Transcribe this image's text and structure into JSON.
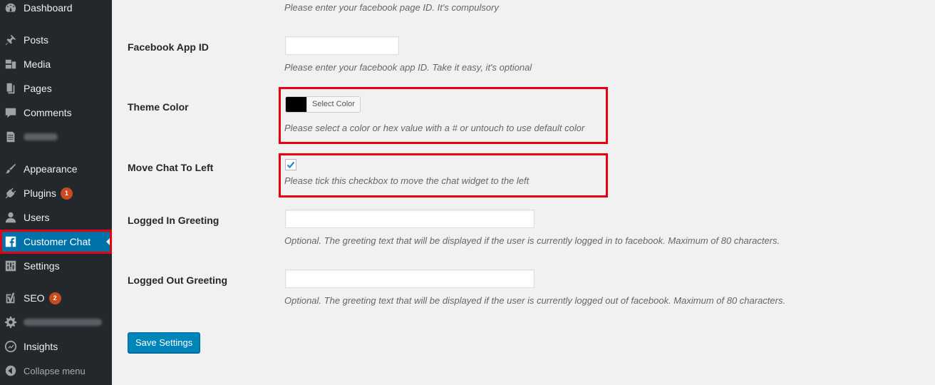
{
  "sidebar": {
    "items": [
      {
        "label": "Dashboard",
        "icon": "dashboard-icon"
      },
      {
        "label": "Posts",
        "icon": "pin-icon"
      },
      {
        "label": "Media",
        "icon": "media-icon"
      },
      {
        "label": "Pages",
        "icon": "pages-icon"
      },
      {
        "label": "Comments",
        "icon": "comment-icon"
      },
      {
        "label": "",
        "icon": "document-icon"
      },
      {
        "label": "Appearance",
        "icon": "paintbrush-icon"
      },
      {
        "label": "Plugins",
        "icon": "plugin-icon",
        "badge": "1"
      },
      {
        "label": "Users",
        "icon": "user-icon"
      },
      {
        "label": "Customer Chat",
        "icon": "facebook-icon"
      },
      {
        "label": "Settings",
        "icon": "settings-icon"
      },
      {
        "label": "SEO",
        "icon": "seo-icon",
        "badge": "2"
      },
      {
        "label": "",
        "icon": "gear-icon"
      },
      {
        "label": "Insights",
        "icon": "insights-icon"
      }
    ],
    "collapse_label": "Collapse menu",
    "active_color": "#0073aa",
    "badge_color": "#ca4a1f"
  },
  "form": {
    "page_id_desc": "Please enter your facebook page ID. It's compulsory",
    "app_id": {
      "label": "Facebook App ID",
      "value": "",
      "desc": "Please enter your facebook app ID. Take it easy, it's optional"
    },
    "theme_color": {
      "label": "Theme Color",
      "value": "#000000",
      "button": "Select Color",
      "desc": "Please select a color or hex value with a # or untouch to use default color"
    },
    "move_left": {
      "label": "Move Chat To Left",
      "checked": true,
      "desc": "Please tick this checkbox to move the chat widget to the left"
    },
    "logged_in": {
      "label": "Logged In Greeting",
      "value": "",
      "desc": "Optional. The greeting text that will be displayed if the user is currently logged in to facebook. Maximum of 80 characters."
    },
    "logged_out": {
      "label": "Logged Out Greeting",
      "value": "",
      "desc": "Optional. The greeting text that will be displayed if the user is currently logged out of facebook. Maximum of 80 characters."
    },
    "save_label": "Save Settings"
  },
  "highlight_color": "#e8000f"
}
